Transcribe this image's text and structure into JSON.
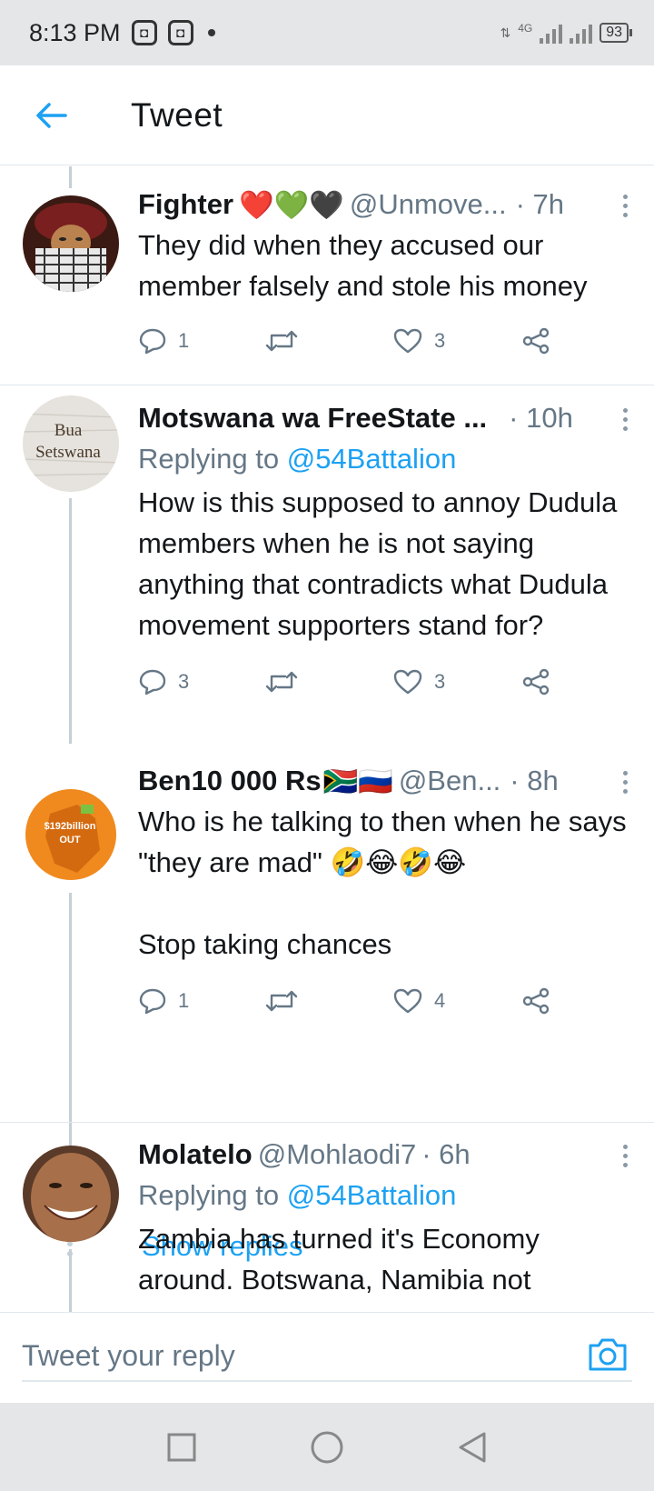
{
  "status_bar": {
    "time": "8:13 PM",
    "network": "4G",
    "battery": "93"
  },
  "header": {
    "title": "Tweet",
    "back_icon": "arrow-left-icon"
  },
  "tweets": [
    {
      "name": "Fighter",
      "name_emoji": "❤️💚🖤",
      "handle": "@Unmove...",
      "time": "· 7h",
      "text": "They did when they accused our member falsely and stole his money",
      "replies": "1",
      "retweets": "",
      "likes": "3"
    },
    {
      "name": "Motswana wa FreeState ...",
      "name_emoji": "",
      "handle": "",
      "time": "· 10h",
      "replying_prefix": "Replying to",
      "replying_to": "@54Battalion",
      "text": "How is this supposed to annoy Dudula members when he is not saying anything that contradicts what Dudula movement supporters stand for?",
      "avatar_text_1": "Bua",
      "avatar_text_2": "Setswana",
      "replies": "3",
      "retweets": "",
      "likes": "3"
    },
    {
      "name": "Ben10 000 Rs",
      "name_emoji": "🇿🇦🇷🇺",
      "handle": "@Ben...",
      "time": "· 8h",
      "text": "Who is he talking to then when he says \"they are mad\" 🤣😂🤣😂\n\nStop taking chances",
      "avatar_text_1": "$192billion",
      "avatar_text_2": "OUT",
      "replies": "1",
      "retweets": "",
      "likes": "4"
    },
    {
      "name": "Molatelo",
      "name_emoji": "",
      "handle": "@Mohlaodi7",
      "time": "· 6h",
      "replying_prefix": "Replying to",
      "replying_to": "@54Battalion",
      "text": "Zambia has turned it's Economy around. Botswana, Namibia not"
    }
  ],
  "show_replies": "Show replies",
  "reply_bar": {
    "placeholder": "Tweet your reply"
  },
  "colors": {
    "accent": "#1da1f2",
    "secondary_text": "#657786",
    "divider": "#e1e8ed"
  }
}
